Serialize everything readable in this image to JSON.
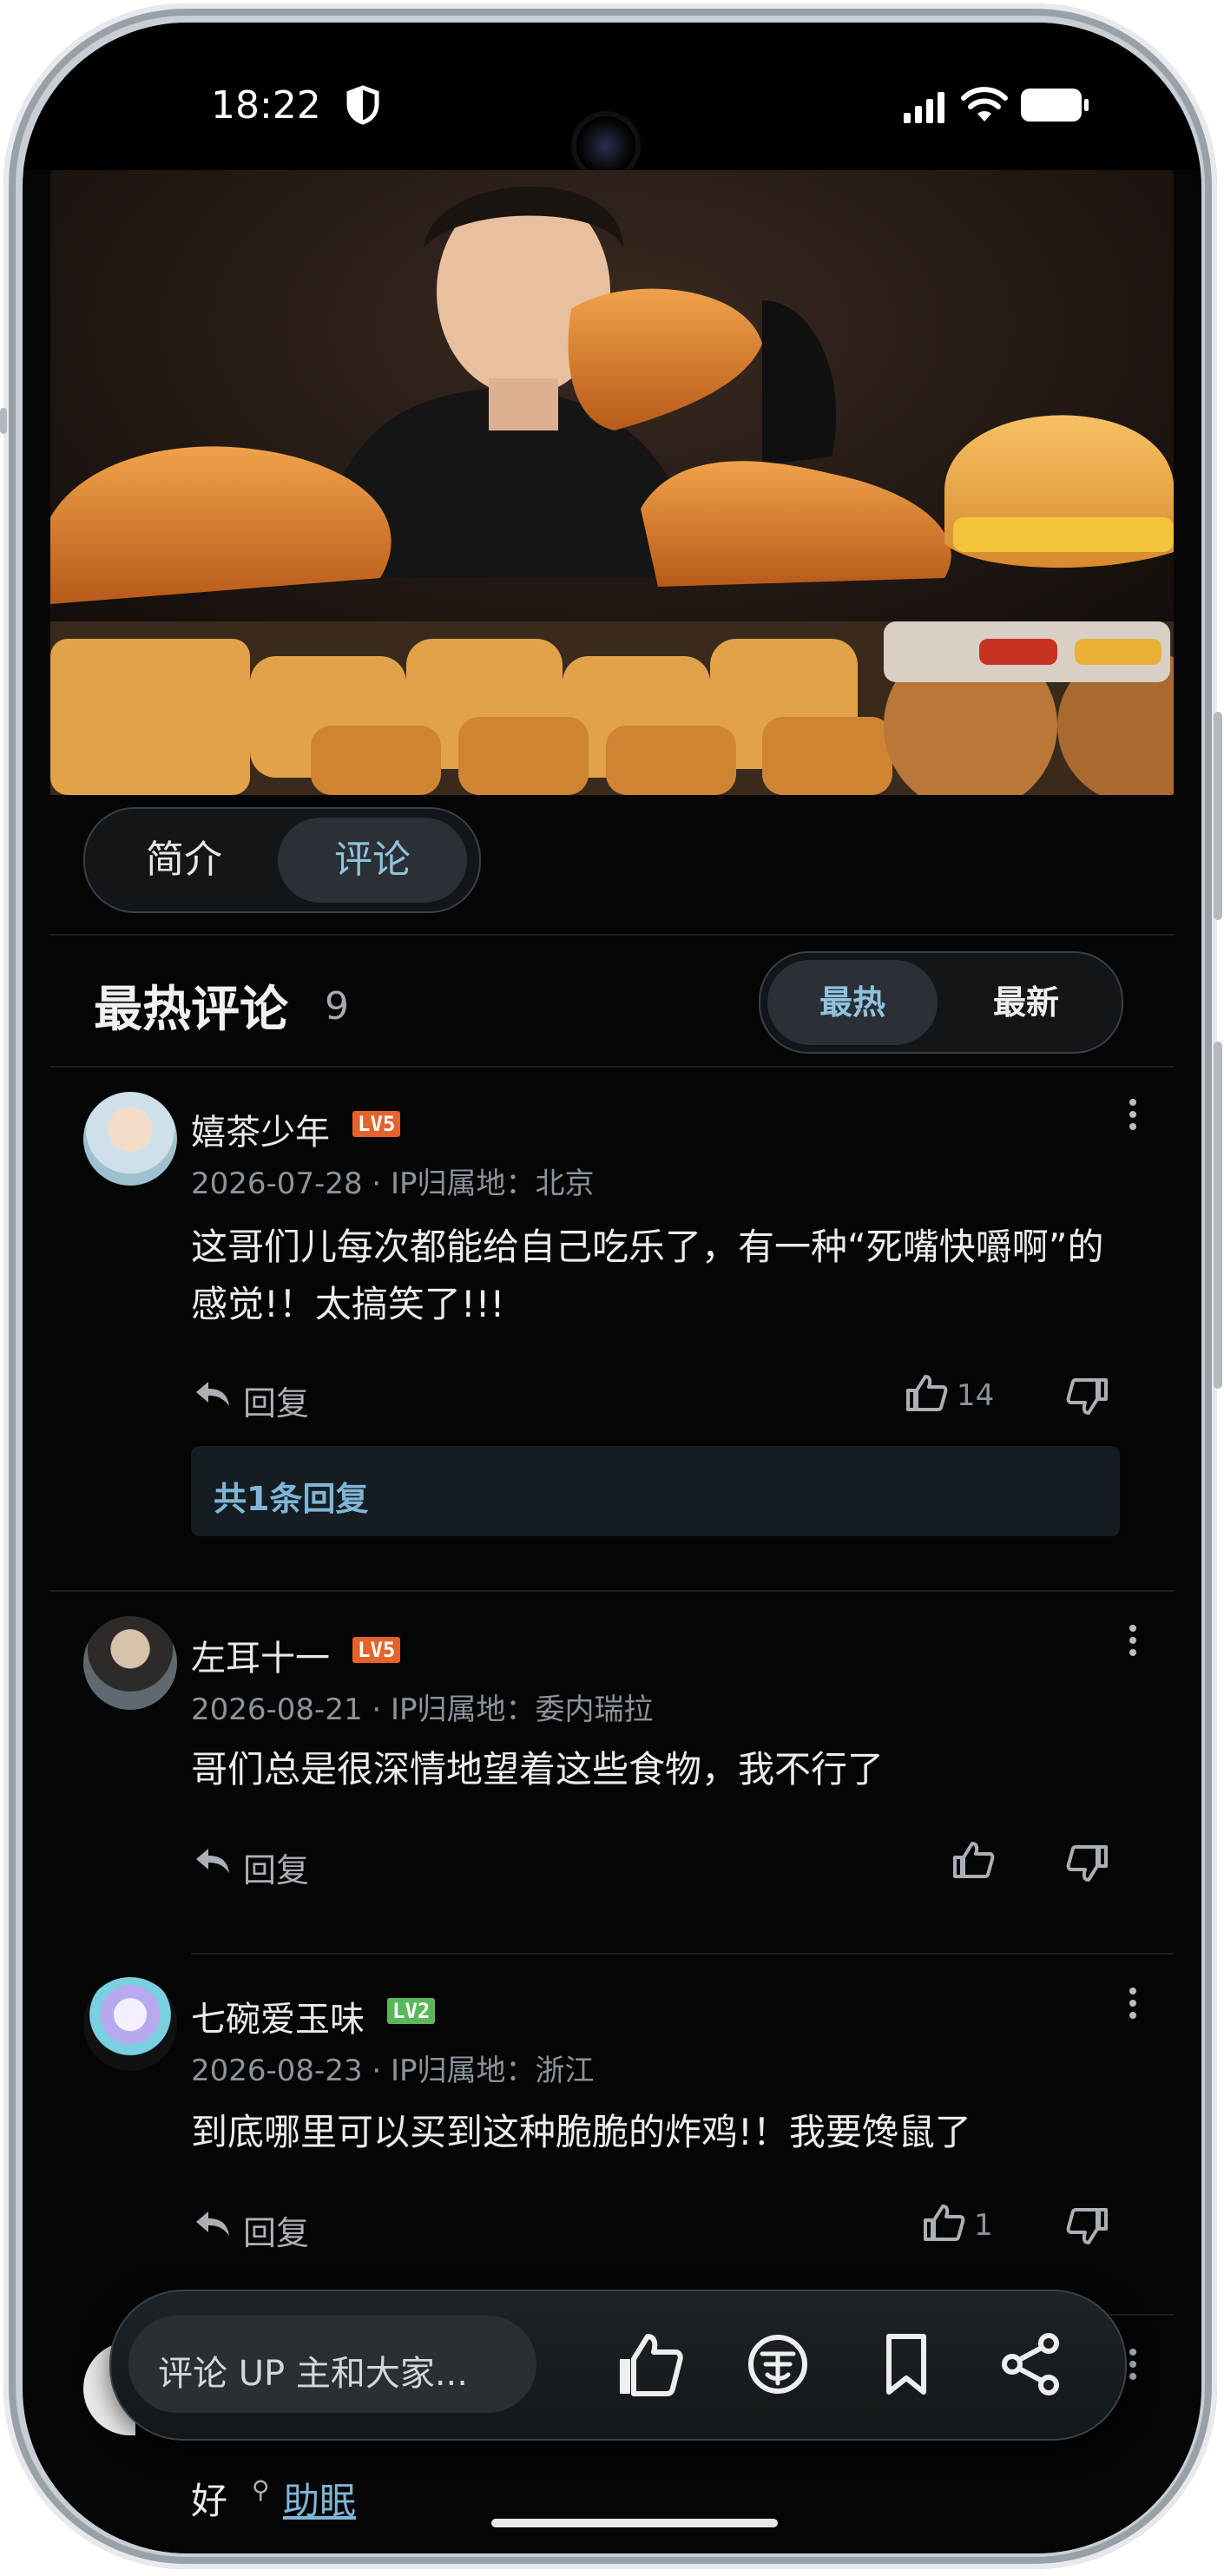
{
  "status": {
    "time": "18:22"
  },
  "tabs": [
    {
      "label": "简介"
    },
    {
      "label": "评论"
    }
  ],
  "comments_header": {
    "title": "最热评论",
    "count": "9"
  },
  "sort": [
    {
      "label": "最热"
    },
    {
      "label": "最新"
    }
  ],
  "comments": [
    {
      "user": "嬉茶少年",
      "level": "LV5",
      "meta": "2026-07-28 · IP归属地：北京",
      "text": "这哥们儿每次都能给自己吃乐了，有一种“死嘴快嚼啊”的感觉!！太搞笑了!!!",
      "reply_label": "回复",
      "likes": "14"
    },
    {
      "user": "左耳十一",
      "level": "LV5",
      "meta": "2026-08-21 · IP归属地：委内瑞拉",
      "text": "哥们总是很深情地望着这些食物，我不行了",
      "reply_label": "回复",
      "likes": ""
    },
    {
      "user": "七碗爱玉味",
      "level": "LV2",
      "meta": "2026-08-23 · IP归属地：浙江",
      "text": "到底哪里可以买到这种脆脆的炸鸡!！我要馋鼠了",
      "reply_label": "回复",
      "likes": "1"
    }
  ],
  "replies_summary": "共1条回复",
  "bottom_bar": {
    "placeholder": "评论 UP 主和大家..."
  },
  "partial_comment": {
    "text": "好",
    "link": "助眠"
  },
  "colors": {
    "lv5": "#e5622a",
    "lv2": "#59b85a",
    "accent": "#7fb6d6"
  }
}
